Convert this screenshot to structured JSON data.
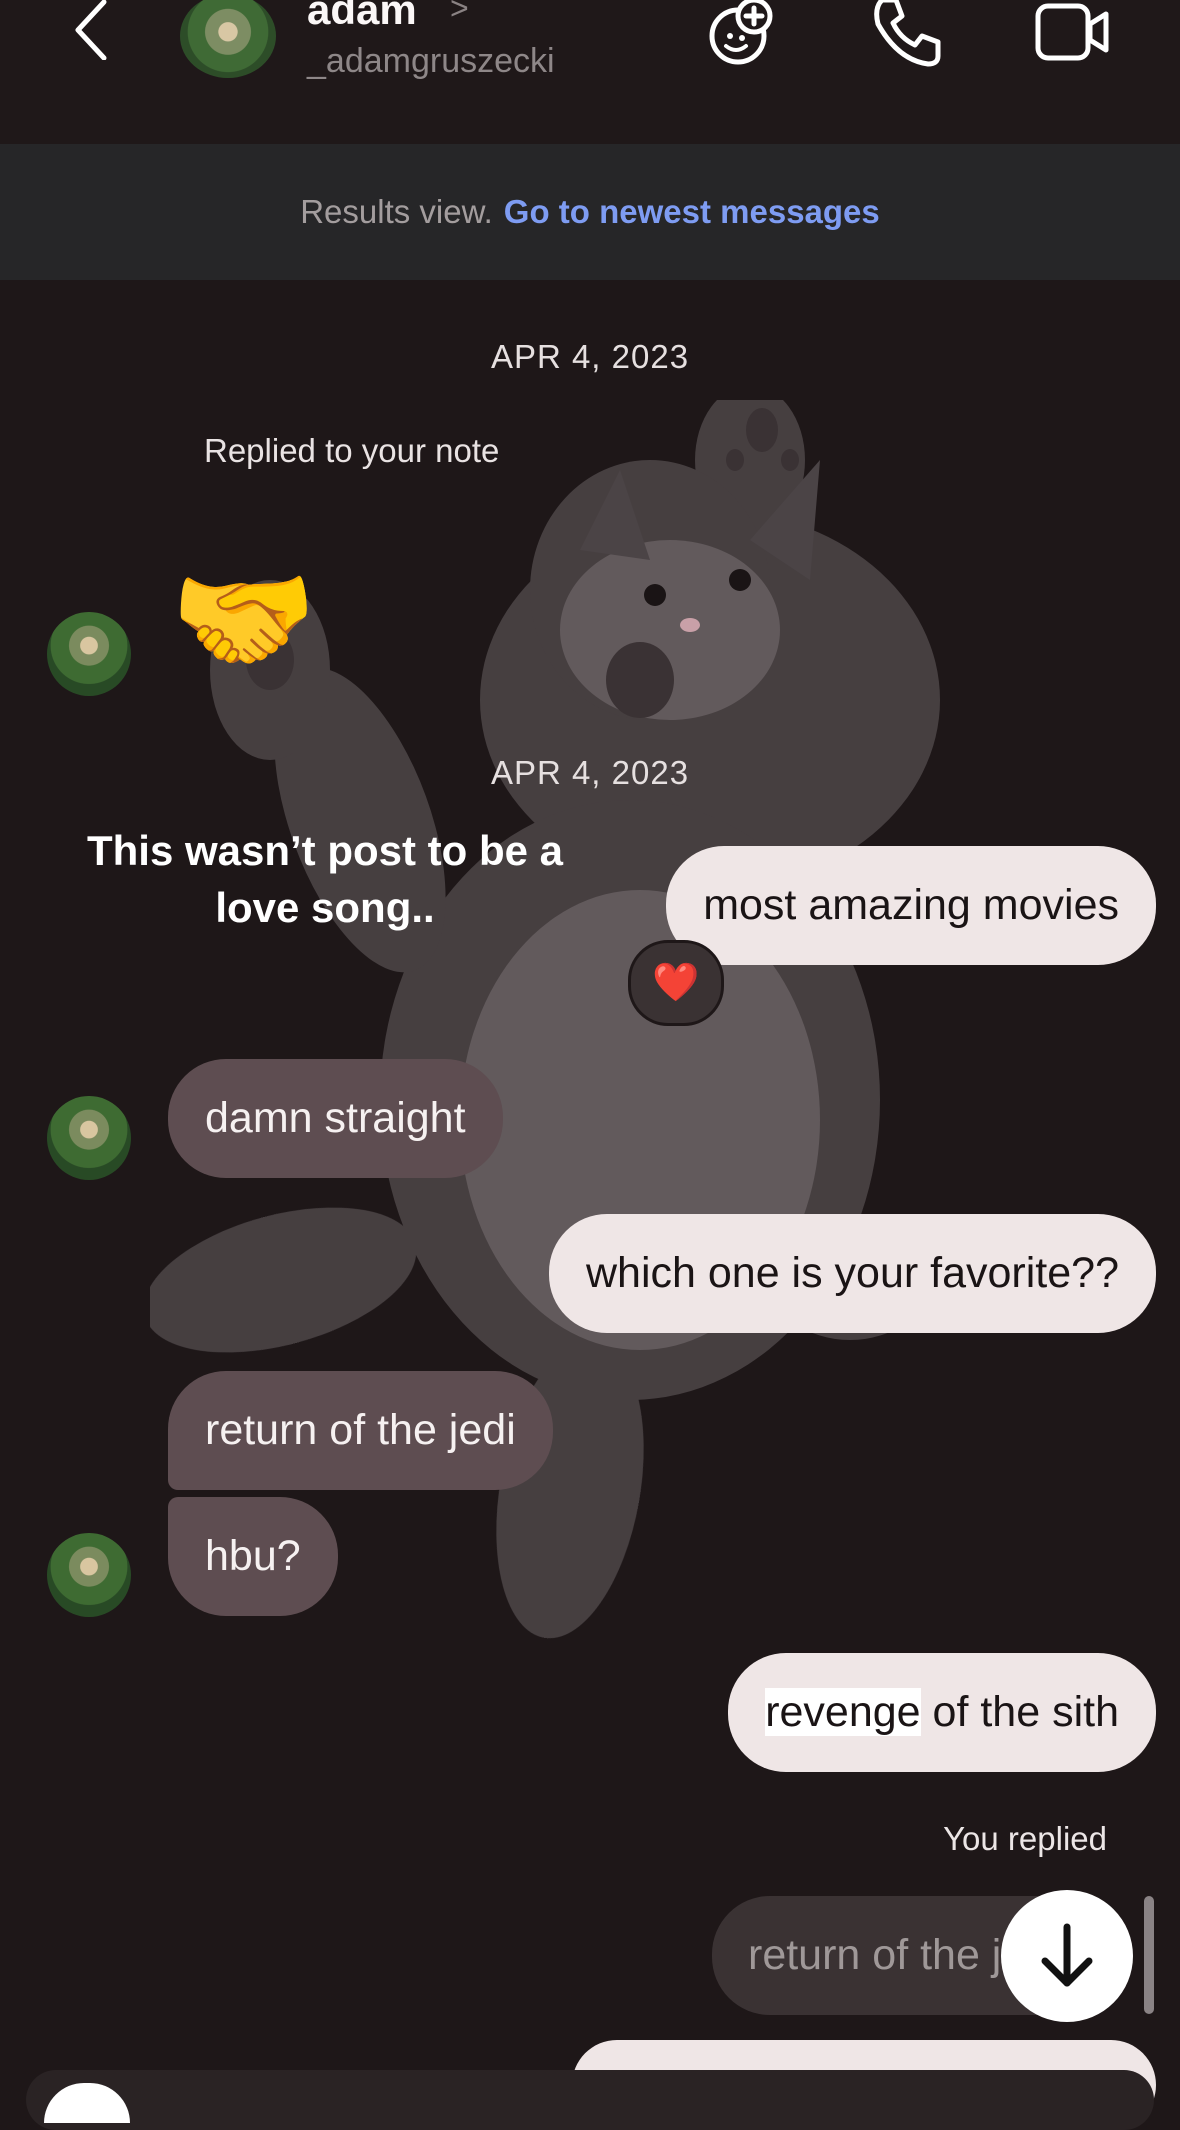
{
  "header": {
    "name": "adam",
    "chevron": ">",
    "username": "_adamgruszecki",
    "icons": [
      "back-icon",
      "effects-icon",
      "phone-icon",
      "video-icon"
    ]
  },
  "banner": {
    "text": "Results view.",
    "link": "Go to newest messages"
  },
  "conversation": {
    "dates": [
      "APR 4, 2023",
      "APR 4, 2023"
    ],
    "note_reply_label": "Replied to your note",
    "note_reply_emoji": "🤝",
    "note_text": "This wasn’t post to be a love song..",
    "messages": [
      {
        "from": "me",
        "text": "most amazing movies",
        "reaction": "❤️"
      },
      {
        "from": "them",
        "text": "damn straight"
      },
      {
        "from": "me",
        "text": "which one is your favorite??"
      },
      {
        "from": "them",
        "text": "return of the jedi"
      },
      {
        "from": "them",
        "text": "hbu?"
      },
      {
        "from": "me",
        "text_highlight": "revenge",
        "text_rest": " of the sith"
      }
    ],
    "you_replied_label": "You replied",
    "reply_preview": "return of the j"
  },
  "colors": {
    "background": "#1e1718",
    "incoming_bubble": "#5e4d51",
    "outgoing_bubble": "#efe6e6",
    "link": "#7e9cf2"
  }
}
